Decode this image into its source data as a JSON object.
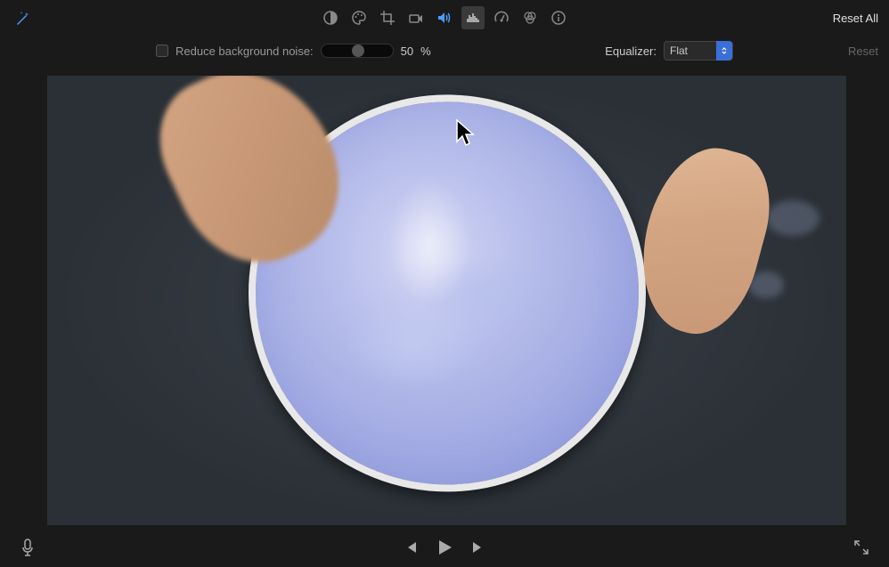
{
  "toolbar": {
    "reset_all_label": "Reset All",
    "icons": {
      "enhance": "auto-enhance-icon",
      "color_balance": "color-balance-icon",
      "color_palette": "color-palette-icon",
      "crop": "crop-icon",
      "stabilization": "stabilization-icon",
      "volume": "volume-icon",
      "noise_eq": "noise-eq-icon",
      "speed": "speed-icon",
      "color_filter": "color-filter-icon",
      "info": "info-icon"
    }
  },
  "controls": {
    "noise_checkbox_checked": false,
    "noise_label": "Reduce background noise:",
    "noise_value": "50",
    "noise_unit": "%",
    "equalizer_label": "Equalizer:",
    "equalizer_value": "Flat",
    "reset_label": "Reset"
  },
  "transport": {
    "voiceover": "voiceover-icon",
    "prev": "previous-icon",
    "play": "play-icon",
    "next": "next-icon",
    "fullscreen": "fullscreen-icon"
  }
}
